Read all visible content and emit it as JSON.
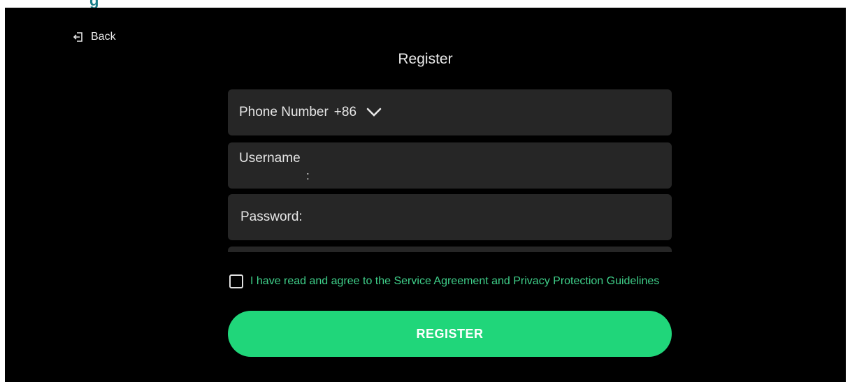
{
  "header": {
    "back_label": "Back",
    "title": "Register",
    "back_icon": "logout-arrow-icon"
  },
  "form": {
    "phone_label": "Phone Number",
    "country_code": "+86",
    "username_label": "Username",
    "username_colon": ":",
    "password_label": "Password:"
  },
  "agreement": {
    "text": "I have read and agree to the Service Agreement and Privacy Protection Guidelines",
    "checked": false
  },
  "actions": {
    "register_label": "REGISTER"
  },
  "colors": {
    "background": "#000000",
    "field_bg": "#262626",
    "accent": "#20d67a",
    "agreement_text": "#3fd08a"
  }
}
